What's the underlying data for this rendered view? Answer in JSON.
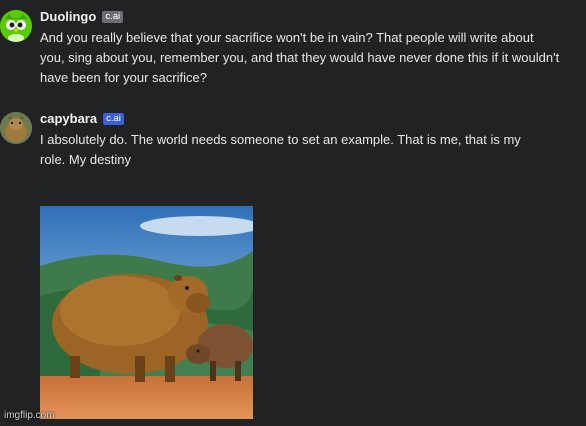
{
  "messages": [
    {
      "author": "Duolingo",
      "badge": "c.ai",
      "text": "And you really believe that your sacrifice won't be in vain? That people will write about you, sing about you, remember you, and that they would have never done this if it wouldn't have been for your sacrifice?",
      "avatar_icon": "duolingo-owl-icon"
    },
    {
      "author": "capybara",
      "badge": "c.ai",
      "text": "I absolutely do. The world needs someone to set an example. That is me, that is my role. My destiny",
      "avatar_icon": "capybara-avatar-icon"
    }
  ],
  "colors": {
    "background": "#202223",
    "duolingo_green": "#58cc02",
    "badge_blue": "#3a5fd6",
    "badge_gray": "#6b6f73"
  },
  "watermark": "imgflip.com"
}
